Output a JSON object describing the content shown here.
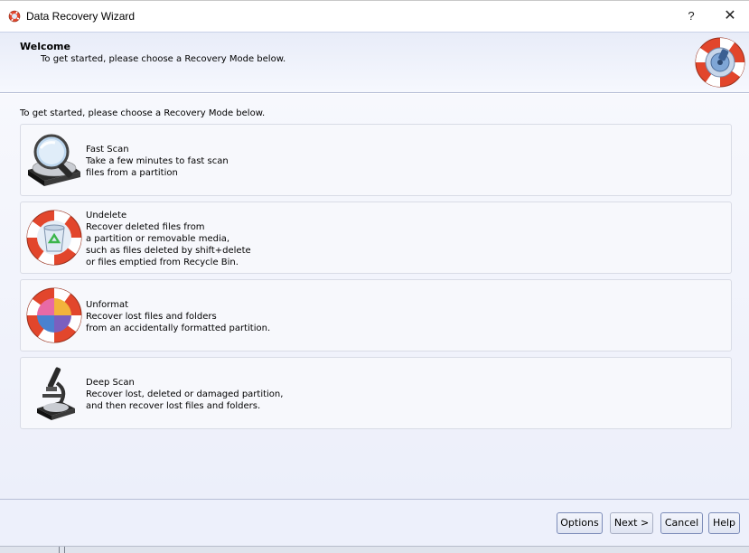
{
  "window": {
    "title": "Data Recovery Wizard",
    "help_button": "?",
    "close_button": "✕"
  },
  "header": {
    "title": "Welcome",
    "subtitle": "To get started, please choose a Recovery Mode below."
  },
  "main": {
    "prompt": "To get started, please choose a Recovery Mode below.",
    "modes": [
      {
        "title": "Fast Scan",
        "description": "Take a few minutes to fast scan\nfiles from a partition",
        "icon": "hard-drive-magnifier-icon"
      },
      {
        "title": "Undelete",
        "description": "Recover deleted files from\na partition or removable media,\nsuch as files deleted by shift+delete\nor files emptied from Recycle Bin.",
        "icon": "lifebuoy-recycle-bin-icon"
      },
      {
        "title": "Unformat",
        "description": "Recover lost files and folders\nfrom an accidentally formatted partition.",
        "icon": "lifebuoy-pie-chart-icon"
      },
      {
        "title": "Deep Scan",
        "description": "Recover lost, deleted or damaged partition,\nand then recover lost files and folders.",
        "icon": "microscope-disk-icon"
      }
    ]
  },
  "footer": {
    "options": "Options",
    "next": "Next >",
    "cancel": "Cancel",
    "help": "Help"
  },
  "colors": {
    "accent": "#7c8cb8",
    "lifebuoy_red": "#e2462c",
    "header_bg": "#e8ecf8"
  }
}
